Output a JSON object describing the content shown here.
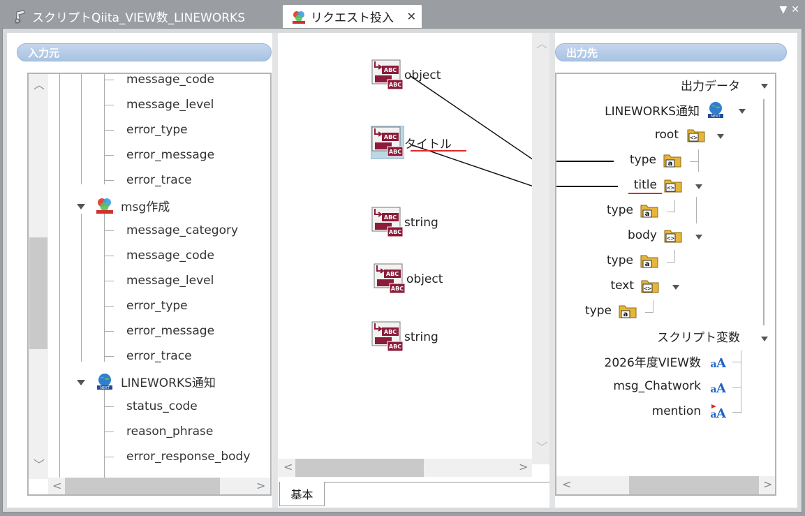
{
  "tabs": [
    {
      "label": "スクリプトQiita_VIEW数_LINEWORKS",
      "icon": "script-icon"
    },
    {
      "label": "リクエスト投入",
      "icon": "request-icon",
      "close": "✕"
    }
  ],
  "window_controls": {
    "menu": "▼",
    "close": "✕"
  },
  "left_panel": {
    "title": "入力元",
    "items_top": [
      "message_code",
      "message_level",
      "error_type",
      "error_message",
      "error_trace"
    ],
    "group1": {
      "label": "msg作成",
      "items": [
        "message_category",
        "message_code",
        "message_level",
        "error_type",
        "error_message",
        "error_trace"
      ]
    },
    "group2": {
      "label": "LINEWORKS通知",
      "items": [
        "status_code",
        "reason_phrase",
        "error_response_body"
      ]
    }
  },
  "center_panel": {
    "nodes": [
      {
        "label": "object"
      },
      {
        "label": "タイトル"
      },
      {
        "label": "string"
      },
      {
        "label": "object"
      },
      {
        "label": "string"
      }
    ],
    "bottom_tab": "基本"
  },
  "right_panel": {
    "title": "出力先",
    "output_root": "出力データ",
    "lineworks": "LINEWORKS通知",
    "root": "root",
    "type1": "type",
    "title_node": "title",
    "type2": "type",
    "body": "body",
    "type3": "type",
    "text": "text",
    "type4": "type",
    "script_vars": "スクリプト変数",
    "vars": [
      "2026年度VIEW数",
      "msg_Chatwork",
      "mention"
    ]
  },
  "colors": {
    "accent_red": "#e0282c",
    "pill_blue": "#a9c3e3",
    "abc_maroon": "#8b1c3a"
  }
}
